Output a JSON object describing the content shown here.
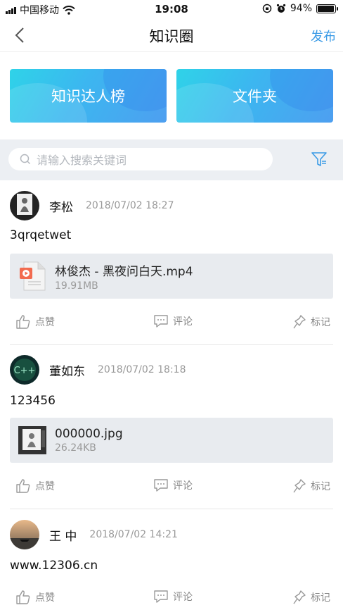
{
  "status": {
    "carrier": "中国移动",
    "time": "19:08",
    "battery": "94%",
    "battery_level": 0.94
  },
  "nav": {
    "title": "知识圈",
    "publish": "发布"
  },
  "banners": [
    "知识达人榜",
    "文件夹"
  ],
  "search": {
    "placeholder": "请输入搜索关键词"
  },
  "actions": {
    "like": "点赞",
    "comment": "评论",
    "mark": "标记"
  },
  "posts": [
    {
      "name": "李松",
      "date": "2018/07/02 18:27",
      "text": "3qrqetwet",
      "file": {
        "name": "林俊杰 - 黑夜问白天.mp4",
        "size": "19.91MB",
        "icon": "video-file-icon"
      }
    },
    {
      "name": "董如东",
      "date": "2018/07/02 18:18",
      "text": "123456",
      "file": {
        "name": "000000.jpg",
        "size": "26.24KB",
        "icon": "image-thumbnail"
      }
    },
    {
      "name": "王 中",
      "date": "2018/07/02 14:21",
      "text": "www.12306.cn"
    }
  ]
}
